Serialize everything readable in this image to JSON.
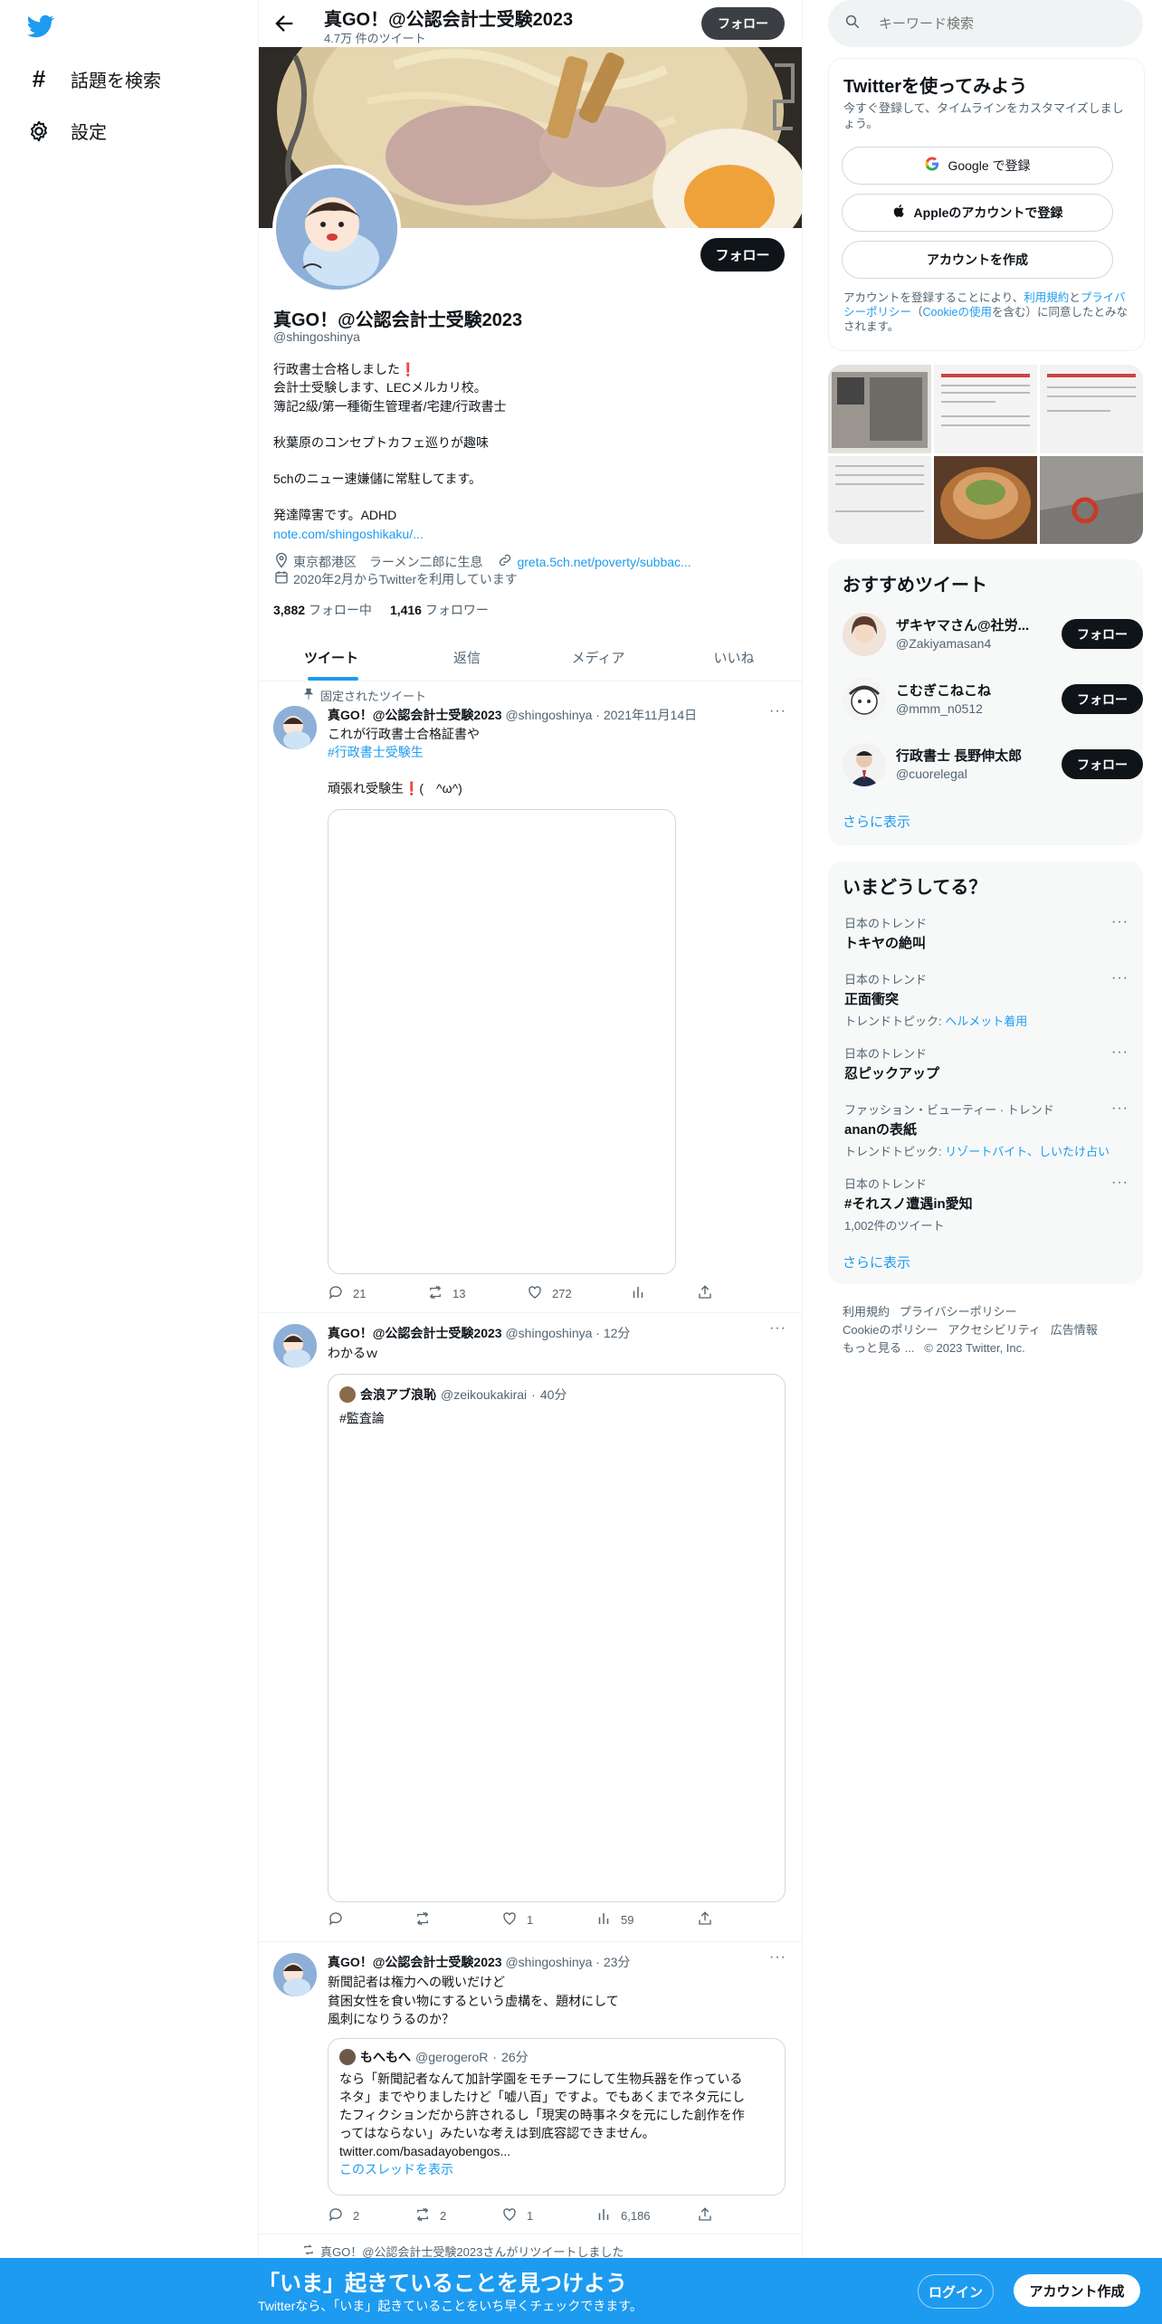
{
  "nav": {
    "explore_label": "話題を検索",
    "settings_label": "設定"
  },
  "header": {
    "name": "真GO！@公認会計士受験2023",
    "tweet_count": "4.7万 件のツイート",
    "follow_label": "フォロー"
  },
  "profile": {
    "name": "真GO！@公認会計士受験2023",
    "handle": "@shingoshinya",
    "bio": [
      "行政書士合格しました❗",
      "会計士受験します、LECメルカリ校。",
      "簿記2級/第一種衛生管理者/宅建/行政書士",
      "",
      "秋葉原のコンセプトカフェ巡りが趣味",
      "",
      "5chのニュー速嫌儲に常駐してます。",
      "",
      "発達障害です。ADHD"
    ],
    "bio_link": "note.com/shingoshikaku/...",
    "location": "東京都港区　ラーメン二郎に生息",
    "website": "greta.5ch.net/poverty/subbac...",
    "joined": "2020年2月からTwitterを利用しています",
    "following_count": "3,882",
    "following_label": "フォロー中",
    "followers_count": "1,416",
    "followers_label": "フォロワー",
    "follow_label": "フォロー"
  },
  "tabs": [
    "ツイート",
    "返信",
    "メディア",
    "いいね"
  ],
  "tweets": [
    {
      "pinned_label": "固定されたツイート",
      "name": "真GO！@公認会計士受験2023",
      "handle": "@shingoshinya",
      "time": "2021年11月14日",
      "line1": "これが行政書士合格証書や",
      "hashtag": "#行政書士受験生",
      "line3": "頑張れ受験生❗(　^ω^)",
      "replies": "21",
      "retweets": "13",
      "likes": "272"
    },
    {
      "name": "真GO！@公認会計士受験2023",
      "handle": "@shingoshinya",
      "time": "12分",
      "text": "わかるｗ",
      "quote_name": "会浪アブ浪恥",
      "quote_handle": "@zeikoukakirai",
      "quote_time": "40分",
      "quote_text": "#監査論",
      "replies": "",
      "retweets": "",
      "likes": "1",
      "views": "59"
    },
    {
      "name": "真GO！@公認会計士受験2023",
      "handle": "@shingoshinya",
      "time": "23分",
      "text": [
        "新聞記者は権力への戦いだけど",
        "貧困女性を食い物にするという虚構を、題材にして",
        "風刺になりうるのか？"
      ],
      "quote_name": "もへもへ",
      "quote_handle": "@gerogeroR",
      "quote_time": "26分",
      "quote_text": [
        "なら「新聞記者なんて加計学園をモチーフにして生物兵器を作っている",
        "ネタ」までやりましたけど「嘘八百」ですよ。でもあくまでネタ元にし",
        "たフィクションだから許されるし「現実の時事ネタを元にした創作を作",
        "ってはならない」みたいな考えは到底容認できません。"
      ],
      "quote_link": "twitter.com/basadayobengos...",
      "thread_label": "このスレッドを表示",
      "replies": "2",
      "retweets": "2",
      "likes": "1",
      "views": "6,186"
    }
  ],
  "retweet_notice": "真GO！@公認会計士受験2023さんがリツイートしました",
  "sidebar": {
    "search_placeholder": "キーワード検索",
    "signup": {
      "title": "Twitterを使ってみよう",
      "subtitle": "今すぐ登録して、タイムラインをカスタマイズしましょう。",
      "google": "Google で登録",
      "apple": "Appleのアカウントで登録",
      "create": "アカウントを作成",
      "terms_1": "アカウントを登録することにより、",
      "terms_link1": "利用規約",
      "terms_2": "と",
      "terms_link2": "プライバシーポリシー",
      "terms_3": "（",
      "terms_link3": "Cookieの使用",
      "terms_4": "を含む）に同意したとみなされます。"
    },
    "recommend_title": "おすすめツイート",
    "recommend": [
      {
        "name": "ザキヤマさん@社労...",
        "handle": "@Zakiyamasan4",
        "follow": "フォロー"
      },
      {
        "name": "こむぎこねこね",
        "handle": "@mmm_n0512",
        "follow": "フォロー"
      },
      {
        "name": "行政書士 長野伸太郎",
        "handle": "@cuorelegal",
        "follow": "フォロー"
      }
    ],
    "show_more": "さらに表示",
    "trends_title": "いまどうしてる？",
    "trends": [
      {
        "cat": "日本のトレンド",
        "name": "トキヤの絶叫",
        "sub_label": "",
        "sub_link": ""
      },
      {
        "cat": "日本のトレンド",
        "name": "正面衝突",
        "sub_label": "トレンドトピック: ",
        "sub_link": "ヘルメット着用"
      },
      {
        "cat": "日本のトレンド",
        "name": "忍ピックアップ",
        "sub_label": "",
        "sub_link": ""
      },
      {
        "cat": "ファッション・ビューティー · トレンド",
        "name": "ananの表紙",
        "sub_label": "トレンドトピック: ",
        "sub_link": "リゾートバイト、しいたけ占い"
      },
      {
        "cat": "日本のトレンド",
        "name": "#それスノ遭遇in愛知",
        "sub_label": "1,002件のツイート",
        "sub_link": ""
      }
    ],
    "trends_more": "さらに表示",
    "footer": {
      "terms": "利用規約",
      "privacy": "プライバシーポリシー",
      "cookie": "Cookieのポリシー",
      "accessibility": "アクセシビリティ",
      "ads": "広告情報",
      "more": "もっと見る ...",
      "copyright": "© 2023 Twitter, Inc."
    }
  },
  "bottom": {
    "title": "「いま」起きていることを見つけよう",
    "subtitle": "Twitterなら、「いま」起きていることをいち早くチェックできます。",
    "login": "ログイン",
    "signup": "アカウント作成"
  },
  "colors": {
    "accent": "#1d9bf0",
    "text": "#0f1419",
    "muted": "#536471",
    "panel": "#f7f9f9"
  }
}
